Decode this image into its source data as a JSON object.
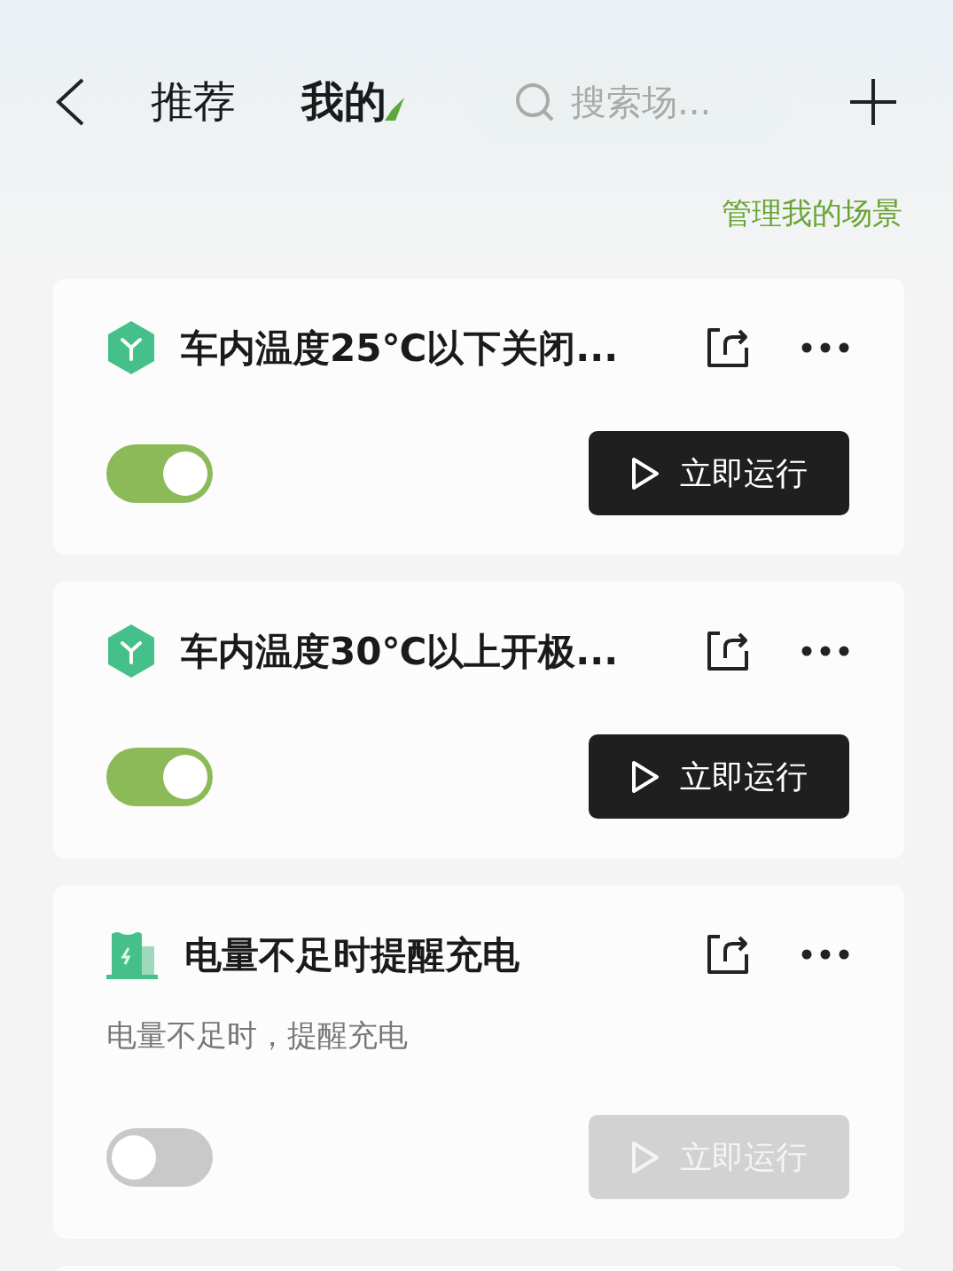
{
  "tabs": [
    {
      "label": "推荐",
      "selected": false
    },
    {
      "label": "我的",
      "selected": true
    }
  ],
  "search": {
    "placeholder": "搜索场..."
  },
  "manage_link": "管理我的场景",
  "scenes": [
    {
      "kind": "cube",
      "title": "车内温度25℃以下关闭...",
      "enabled": true,
      "run_button": "立即运行"
    },
    {
      "kind": "cube",
      "title": "车内温度30℃以上开极...",
      "enabled": true,
      "run_button": "立即运行"
    },
    {
      "kind": "battery",
      "title": "电量不足时提醒充电",
      "description": "电量不足时，提醒充电",
      "enabled": false,
      "run_button": "立即运行"
    }
  ]
}
